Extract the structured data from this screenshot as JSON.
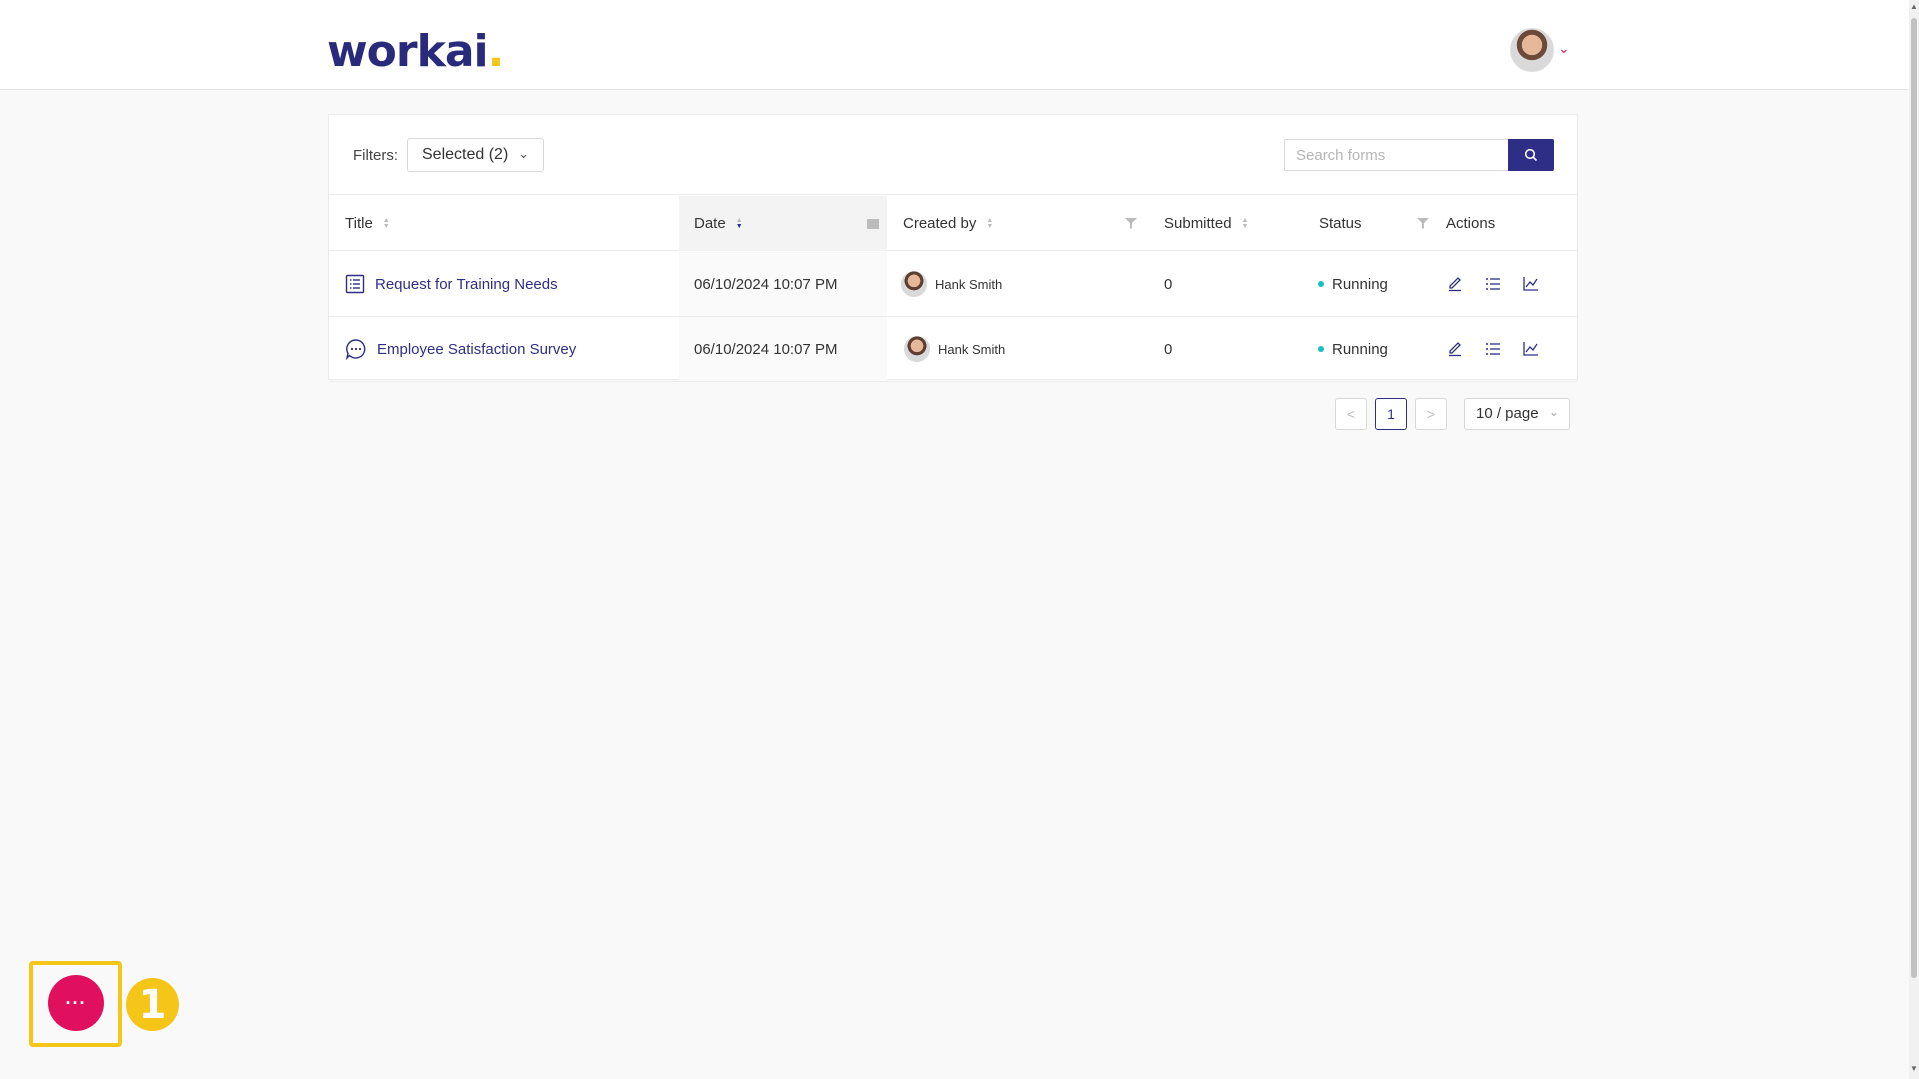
{
  "app": {
    "logo_text": "workai",
    "logo_dot": ".",
    "brand_color": "#2e2e86",
    "accent_color": "#f5c518",
    "fab_color": "#e0105e"
  },
  "header": {
    "avatar_icon": "user-avatar",
    "menu_icon": "chevron-down-icon"
  },
  "filters": {
    "label": "Filters:",
    "selected_value": "Selected (2)"
  },
  "search": {
    "placeholder": "Search forms",
    "button_icon": "search-icon"
  },
  "table": {
    "columns": [
      "Title",
      "Date",
      "Created by",
      "Submitted",
      "Status",
      "Actions"
    ],
    "rows": [
      {
        "icon": "list-form-icon",
        "title": "Request for Training Needs",
        "date": "06/10/2024 10:07 PM",
        "created_by": "Hank Smith",
        "submitted": "0",
        "status": "Running",
        "status_color": "#13c2c2"
      },
      {
        "icon": "chat-bubble-icon",
        "title": "Employee Satisfaction Survey",
        "date": "06/10/2024 10:07 PM",
        "created_by": "Hank Smith",
        "submitted": "0",
        "status": "Running",
        "status_color": "#13c2c2"
      }
    ],
    "action_icons": [
      "edit-icon",
      "list-icon",
      "chart-icon"
    ]
  },
  "pagination": {
    "prev": "<",
    "current_page": "1",
    "next": ">",
    "page_size": "10 / page"
  },
  "fab": {
    "label": "···",
    "step_badge": "1"
  }
}
